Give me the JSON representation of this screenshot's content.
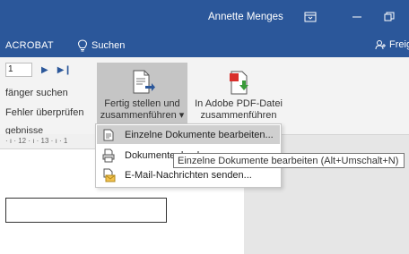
{
  "titlebar": {
    "user": "Annette Menges"
  },
  "tabs": {
    "acrobat": "ACROBAT",
    "search": "Suchen",
    "share": "Freige"
  },
  "left_group": {
    "page_number": "1",
    "line1": "fänger suchen",
    "line2": "Fehler überprüfen",
    "line3": "gebnisse"
  },
  "buttons": {
    "finish_merge_line1": "Fertig stellen und",
    "finish_merge_line2": "zusammenführen",
    "pdf_merge_line1": "In Adobe PDF-Datei",
    "pdf_merge_line2": "zusammenführen"
  },
  "ruler": {
    "text": "· ı · 12 · ı · 13 · ı · 1"
  },
  "menu": {
    "items": [
      {
        "label": "Einzelne Dokumente bearbeiten..."
      },
      {
        "label": "Dokumente drucken..."
      },
      {
        "label": "E-Mail-Nachrichten senden..."
      }
    ]
  },
  "tooltip": {
    "text": "Einzelne Dokumente bearbeiten (Alt+Umschalt+N)"
  },
  "colors": {
    "accent": "#2b579a",
    "ribbon": "#f3f3f3",
    "highlight": "#cfcfcf"
  }
}
